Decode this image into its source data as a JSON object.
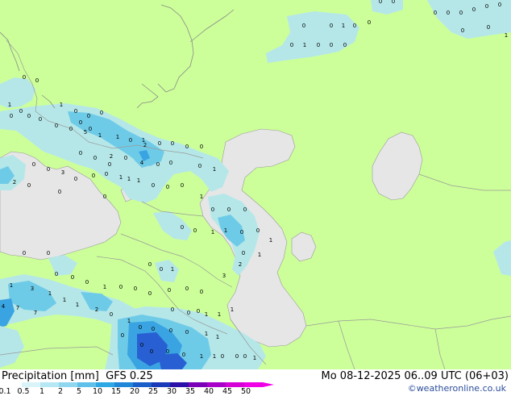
{
  "header": {
    "title": "Precipitation [mm]",
    "model": "GFS 0.25",
    "valid_time": "Mo 08-12-2025 06..09 UTC (06+03)",
    "credit": "©weatheronline.co.uk"
  },
  "legend": {
    "labels": [
      "0.1",
      "0.5",
      "1",
      "2",
      "5",
      "10",
      "15",
      "20",
      "25",
      "30",
      "35",
      "40",
      "45",
      "50"
    ],
    "colors": [
      "#ffffff",
      "#d8f4f8",
      "#b6e8f3",
      "#8fd6ef",
      "#5fc1ea",
      "#2ea8e4",
      "#1f86d8",
      "#1a5ec9",
      "#1a3bb9",
      "#2a10a8",
      "#7a00b8",
      "#a800c8",
      "#d400d6",
      "#f000e6"
    ]
  },
  "colors": {
    "land": "#ccff99",
    "water": "#e6e6e6",
    "precip_light": "#b5e7e9",
    "precip_medium": "#6ecbe8",
    "precip_heavy": "#3aa4e2",
    "precip_intense": "#2860d3",
    "border": "#9a9a9a"
  },
  "markers": [
    "0",
    "0",
    "0",
    "0",
    "0",
    "0",
    "1",
    "0",
    "0",
    "0",
    "0",
    "1",
    "0",
    "0",
    "0",
    "0",
    "0",
    "0",
    "0",
    "0",
    "1",
    "0",
    "0",
    "1",
    "0",
    "0",
    "0",
    "0",
    "0",
    "0",
    "1",
    "0",
    "0",
    "0",
    "0",
    "0",
    "5",
    "1",
    "1",
    "0",
    "1",
    "2",
    "0",
    "0",
    "0",
    "0",
    "2",
    "0",
    "4",
    "0",
    "0",
    "0",
    "0",
    "0",
    "1",
    "1",
    "3",
    "0",
    "0",
    "0",
    "0",
    "0",
    "2",
    "0",
    "0",
    "0",
    "1",
    "0",
    "0",
    "0",
    "1",
    "0",
    "1",
    "0",
    "0",
    "0",
    "0",
    "0",
    "1",
    "1",
    "0",
    "0",
    "1",
    "0",
    "1",
    "2",
    "3",
    "0",
    "0",
    "1",
    "0",
    "0",
    "0",
    "0",
    "0",
    "1",
    "0",
    "0",
    "0",
    "0",
    "0",
    "0",
    "0",
    "0",
    "0",
    "1",
    "1",
    "1",
    "1",
    "0",
    "0",
    "0",
    "0",
    "1",
    "1",
    "0",
    "0",
    "0",
    "0",
    "0",
    "1",
    "1",
    "0",
    "0",
    "0",
    "1",
    "1",
    "3",
    "1",
    "1",
    "1",
    "4",
    "7",
    "7",
    "2",
    "0",
    "1",
    "1",
    "1",
    "2"
  ]
}
